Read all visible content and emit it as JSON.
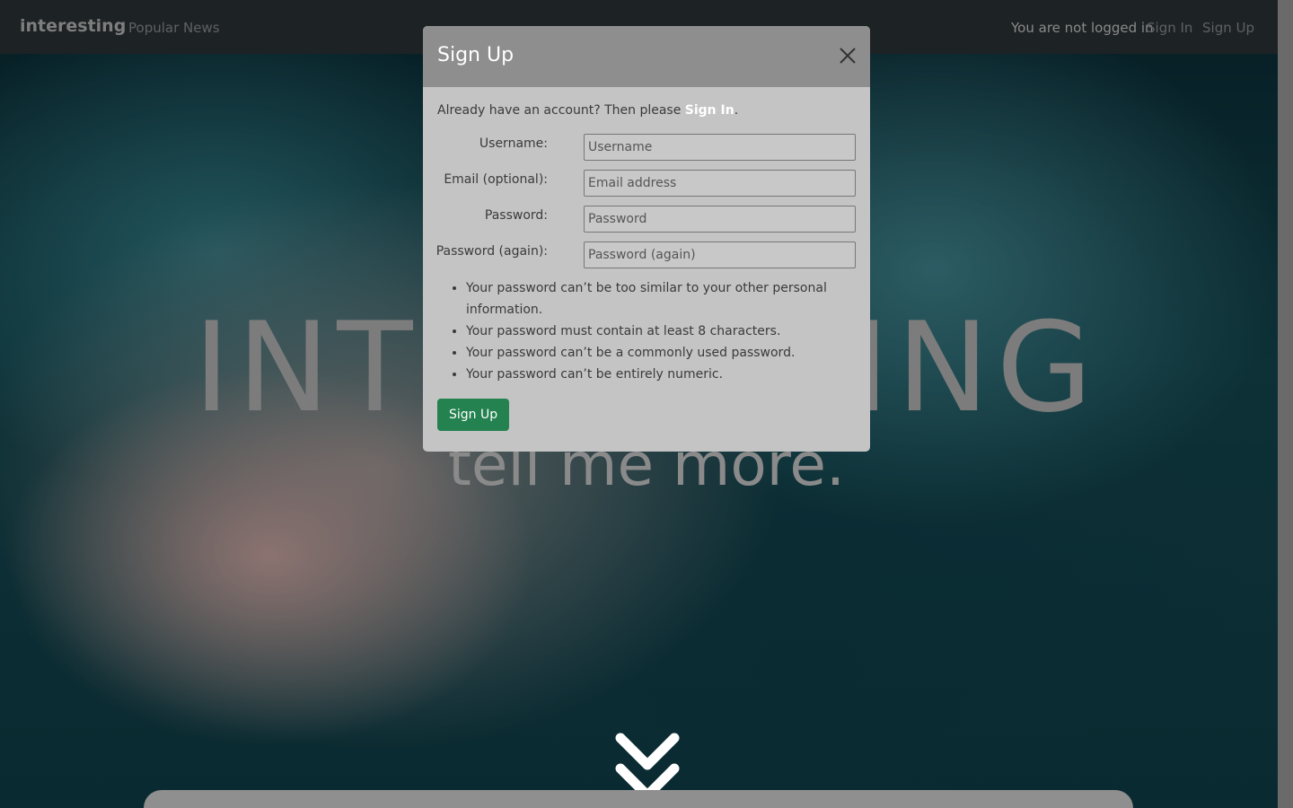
{
  "navbar": {
    "brand": "interesting",
    "popular_news": "Popular News",
    "status": "You are not logged in",
    "sign_in": "Sign In",
    "sign_up": "Sign Up"
  },
  "hero": {
    "title": "INTERESTING",
    "subtitle": "tell me more."
  },
  "modal": {
    "title": "Sign Up",
    "close_icon": "close-icon",
    "signin_prefix": "Already have an account? Then please ",
    "signin_link": "Sign In",
    "signin_suffix": ".",
    "fields": {
      "username": {
        "label": "Username:",
        "placeholder": "Username"
      },
      "email": {
        "label": "Email (optional):",
        "placeholder": "Email address"
      },
      "password": {
        "label": "Password:",
        "placeholder": "Password"
      },
      "password2": {
        "label": "Password (again):",
        "placeholder": "Password (again)"
      }
    },
    "help": [
      "Your password can’t be too similar to your other personal information.",
      "Your password must contain at least 8 characters.",
      "Your password can’t be a commonly used password.",
      "Your password can’t be entirely numeric."
    ],
    "submit": "Sign Up"
  },
  "colors": {
    "submit_bg": "#23824f",
    "modal_header": "#8e8e8e",
    "modal_body": "#c4c4c4",
    "navbar": "#1d2224"
  },
  "icons": {
    "scroll_down": "double-chevron-down-icon"
  }
}
